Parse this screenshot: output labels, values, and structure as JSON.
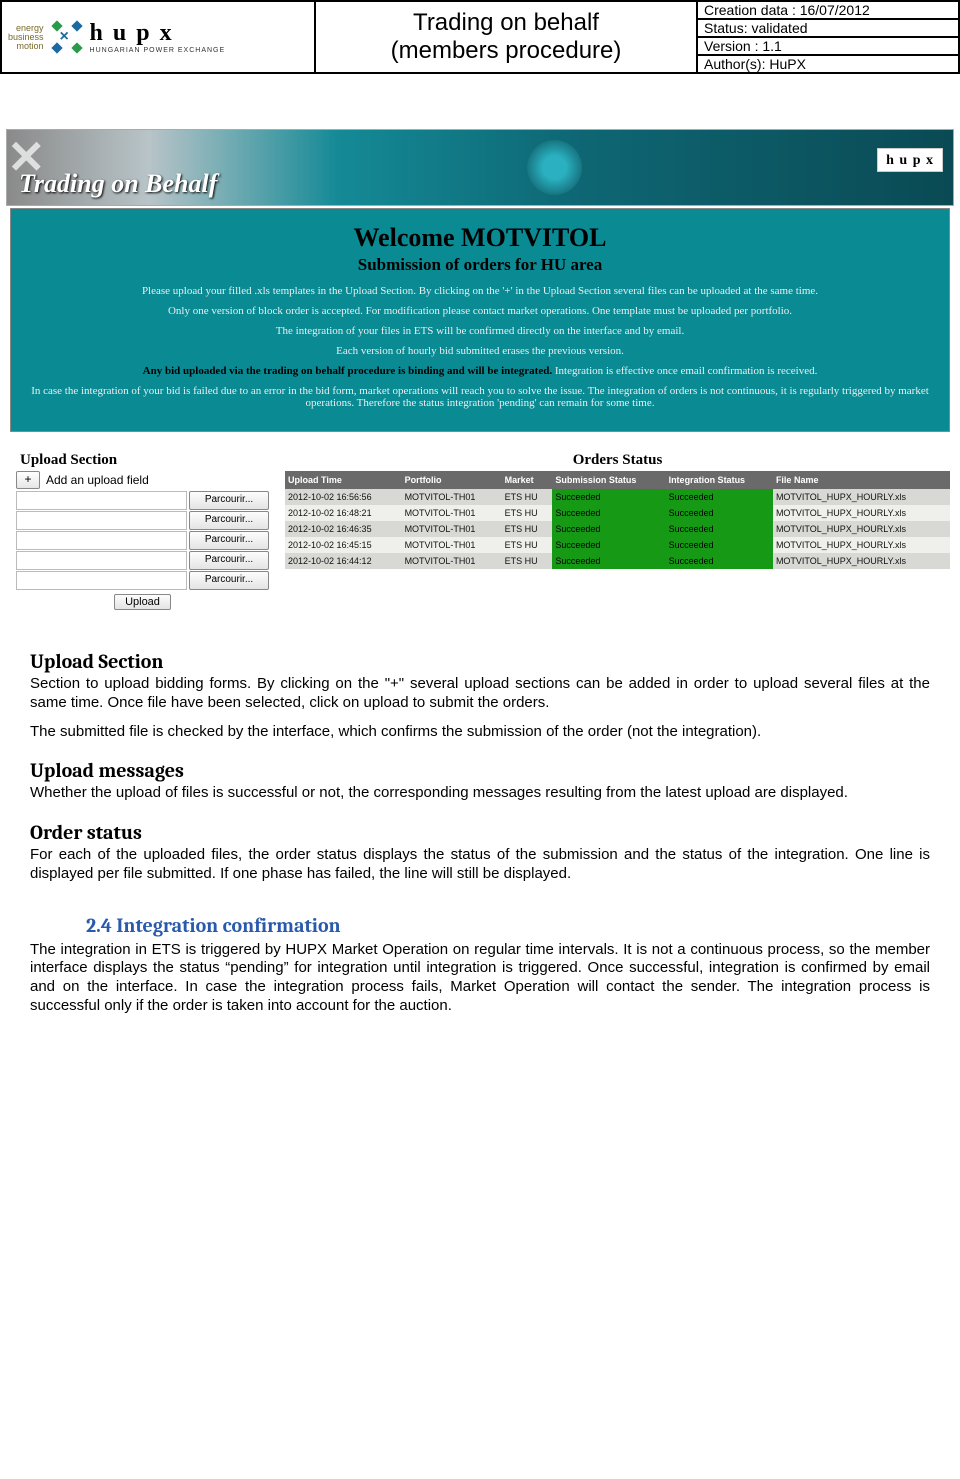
{
  "header": {
    "ebm_lines": [
      "energy",
      "business",
      "motion"
    ],
    "brand": "h u p x",
    "brand_sub": "HUNGARIAN POWER EXCHANGE",
    "title_l1": "Trading on behalf",
    "title_l2": "(members procedure)",
    "meta": {
      "creation": "Creation data : 16/07/2012",
      "status": "Status: validated",
      "version": "Version : 1.1",
      "author": "Author(s): HuPX"
    }
  },
  "banner": {
    "title": "Trading on Behalf",
    "corner_brand": "h u p x"
  },
  "teal": {
    "h1": "Welcome MOTVITOL",
    "h2": "Submission of orders for HU area",
    "p1": "Please upload your filled .xls templates in the Upload Section. By clicking on the '+' in the Upload Section several files can be uploaded at the same time.",
    "p2": "Only one version of block order is accepted. For modification please contact market operations. One template must be uploaded per portfolio.",
    "p3": "The integration of your files in ETS will be confirmed directly on the interface and by email.",
    "p4": "Each version of hourly bid submitted erases the previous version.",
    "p5_bold": "Any bid uploaded via the trading on behalf procedure is binding and will be integrated.",
    "p5_rest": " Integration is effective once email confirmation is received.",
    "p6": "In case the integration of your bid is failed due to an error in the bid form, market operations will reach you to solve the issue. The integration of orders is not continuous, it is regularly triggered by market operations. Therefore the status integration 'pending' can remain for some time."
  },
  "upload": {
    "heading": "Upload Section",
    "add_label": "Add an upload field",
    "plus": "+",
    "browse_label": "Parcourir...",
    "row_count": 5,
    "submit": "Upload"
  },
  "orders": {
    "heading": "Orders Status",
    "cols": [
      "Upload Time",
      "Portfolio",
      "Market",
      "Submission Status",
      "Integration Status",
      "File Name"
    ],
    "rows": [
      {
        "time": "2012-10-02 16:56:56",
        "portfolio": "MOTVITOL-TH01",
        "market": "ETS HU",
        "sub": "Succeeded",
        "int": "Succeeded",
        "file": "MOTVITOL_HUPX_HOURLY.xls"
      },
      {
        "time": "2012-10-02 16:48:21",
        "portfolio": "MOTVITOL-TH01",
        "market": "ETS HU",
        "sub": "Succeeded",
        "int": "Succeeded",
        "file": "MOTVITOL_HUPX_HOURLY.xls"
      },
      {
        "time": "2012-10-02 16:46:35",
        "portfolio": "MOTVITOL-TH01",
        "market": "ETS HU",
        "sub": "Succeeded",
        "int": "Succeeded",
        "file": "MOTVITOL_HUPX_HOURLY.xls"
      },
      {
        "time": "2012-10-02 16:45:15",
        "portfolio": "MOTVITOL-TH01",
        "market": "ETS HU",
        "sub": "Succeeded",
        "int": "Succeeded",
        "file": "MOTVITOL_HUPX_HOURLY.xls"
      },
      {
        "time": "2012-10-02 16:44:12",
        "portfolio": "MOTVITOL-TH01",
        "market": "ETS HU",
        "sub": "Succeeded",
        "int": "Succeeded",
        "file": "MOTVITOL_HUPX_HOURLY.xls"
      }
    ]
  },
  "body": {
    "s1_h": "Upload Section",
    "s1_p1": "Section to upload bidding forms. By clicking on the \"+\" several upload sections can be added in order to upload several files at the same time. Once file have been selected, click on upload to submit the orders.",
    "s1_p2": "The submitted file is checked by the interface, which confirms the submission of the order (not the integration).",
    "s2_h": "Upload messages",
    "s2_p": "Whether the upload of files is successful or not, the corresponding messages resulting from the latest upload are displayed.",
    "s3_h": "Order status",
    "s3_p": "For each of the uploaded files, the order status displays the status of the submission and the status of the integration. One line is displayed per file submitted. If one phase has failed, the line will still be displayed.",
    "s4_num": "2.4   Integration confirmation",
    "s4_p": "The integration in ETS is triggered by HUPX Market Operation on regular time intervals. It is not a continuous process, so the member interface displays the status “pending” for integration until integration is triggered. Once successful, integration is confirmed by email and on the interface. In case the integration process fails, Market Operation will contact the sender. The integration process is successful only if the order is taken into account for the auction."
  }
}
